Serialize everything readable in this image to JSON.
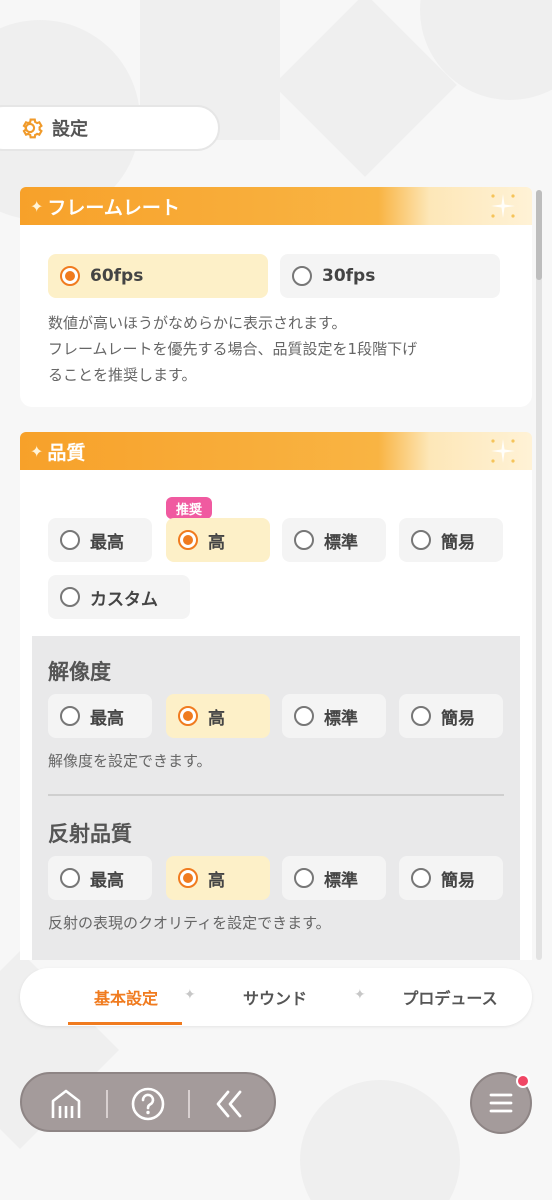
{
  "header": {
    "title": "設定",
    "icon": "gear-icon"
  },
  "framerate": {
    "title": "フレームレート",
    "options": [
      {
        "label": "60fps",
        "selected": true
      },
      {
        "label": "30fps",
        "selected": false
      }
    ],
    "description_line1": "数値が高いほうがなめらかに表示されます。",
    "description_line2": "フレームレートを優先する場合、品質設定を1段階下げ",
    "description_line3": "ることを推奨します。"
  },
  "quality": {
    "title": "品質",
    "recommended_badge": "推奨",
    "options": [
      {
        "label": "最高",
        "selected": false
      },
      {
        "label": "高",
        "selected": true
      },
      {
        "label": "標準",
        "selected": false
      },
      {
        "label": "簡易",
        "selected": false
      },
      {
        "label": "カスタム",
        "selected": false
      }
    ],
    "resolution": {
      "title": "解像度",
      "options": [
        {
          "label": "最高",
          "selected": false
        },
        {
          "label": "高",
          "selected": true
        },
        {
          "label": "標準",
          "selected": false
        },
        {
          "label": "簡易",
          "selected": false
        }
      ],
      "description": "解像度を設定できます。"
    },
    "reflection": {
      "title": "反射品質",
      "options": [
        {
          "label": "最高",
          "selected": false
        },
        {
          "label": "高",
          "selected": true
        },
        {
          "label": "標準",
          "selected": false
        },
        {
          "label": "簡易",
          "selected": false
        }
      ],
      "description": "反射の表現のクオリティを設定できます。"
    }
  },
  "tabs": [
    {
      "label": "基本設定",
      "active": true
    },
    {
      "label": "サウンド",
      "active": false
    },
    {
      "label": "プロデュース",
      "active": false
    }
  ],
  "bottom_nav": {
    "icons": [
      "home-icon",
      "help-icon",
      "back-icon"
    ],
    "menu_icon": "menu-icon",
    "has_notification": true
  },
  "colors": {
    "accent": "#f07b1f",
    "header_gradient_start": "#f7a12a",
    "selected_bg": "#fdf0c8",
    "badge": "#f05aa0",
    "nav_bg": "#a49b9b",
    "notification": "#f04664"
  }
}
